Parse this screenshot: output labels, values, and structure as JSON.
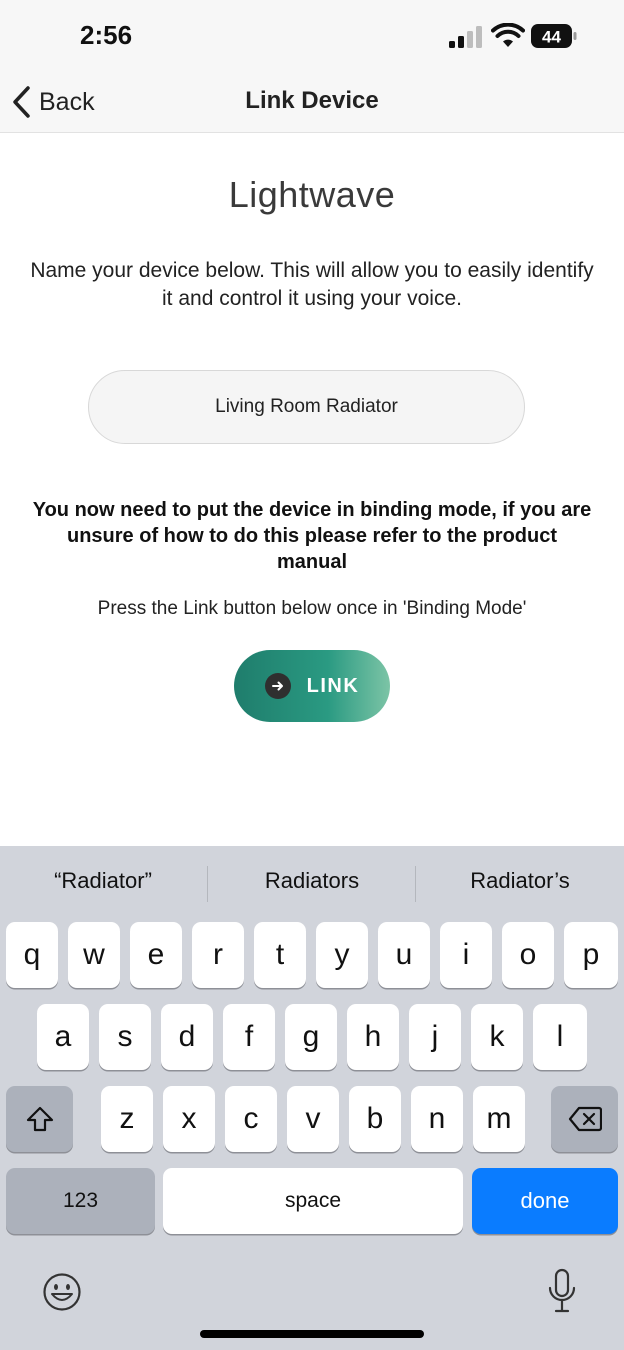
{
  "status_bar": {
    "time": "2:56",
    "battery_level": "44"
  },
  "nav": {
    "back_label": "Back",
    "title": "Link Device"
  },
  "content": {
    "logo_text": "Lightwave",
    "intro": "Name your device below. This will allow you to easily identify it and control it using your voice.",
    "device_name_value": "Living Room Radiator",
    "binding_instruction": "You now need to put the device in binding mode, if you are unsure of how to do this please refer to the product manual",
    "press_instruction": "Press the Link button below once in 'Binding Mode'",
    "link_button_label": "LINK"
  },
  "keyboard": {
    "suggestions": [
      "“Radiator”",
      "Radiators",
      "Radiator’s"
    ],
    "row1": [
      "q",
      "w",
      "e",
      "r",
      "t",
      "y",
      "u",
      "i",
      "o",
      "p"
    ],
    "row2": [
      "a",
      "s",
      "d",
      "f",
      "g",
      "h",
      "j",
      "k",
      "l"
    ],
    "row3": [
      "z",
      "x",
      "c",
      "v",
      "b",
      "n",
      "m"
    ],
    "numbers_key": "123",
    "space_key": "space",
    "done_key": "done"
  },
  "colors": {
    "accent": "#0a7cff",
    "link_gradient_start": "#1f7d6c",
    "link_gradient_end": "#7cc4a6",
    "keyboard_bg": "#d1d4db"
  },
  "icons": [
    "back-chevron-icon",
    "cellular-signal-icon",
    "wifi-icon",
    "battery-icon",
    "arrow-right-icon",
    "shift-icon",
    "backspace-icon",
    "emoji-icon",
    "microphone-icon"
  ]
}
